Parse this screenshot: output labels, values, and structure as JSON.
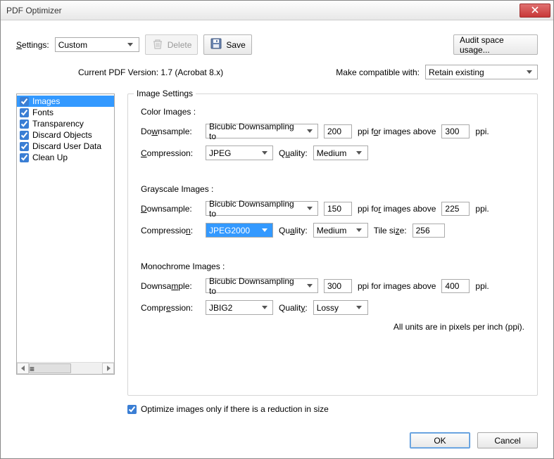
{
  "window": {
    "title": "PDF Optimizer"
  },
  "toolbar": {
    "settings_label": "Settings:",
    "settings_value": "Custom",
    "delete_label": "Delete",
    "save_label": "Save",
    "audit_label": "Audit space usage..."
  },
  "version_row": {
    "current_pdf": "Current PDF Version: 1.7 (Acrobat 8.x)",
    "compat_label": "Make compatible with:",
    "compat_value": "Retain existing"
  },
  "sidebar": {
    "items": [
      {
        "label": "Images",
        "checked": true,
        "selected": true
      },
      {
        "label": "Fonts",
        "checked": true,
        "selected": false
      },
      {
        "label": "Transparency",
        "checked": true,
        "selected": false
      },
      {
        "label": "Discard Objects",
        "checked": true,
        "selected": false
      },
      {
        "label": "Discard User Data",
        "checked": true,
        "selected": false
      },
      {
        "label": "Clean Up",
        "checked": true,
        "selected": false
      }
    ]
  },
  "panel": {
    "title": "Image Settings",
    "color": {
      "title": "Color Images :",
      "downsample_label": "Downsample:",
      "downsample_value": "Bicubic Downsampling to",
      "ppi1": "200",
      "above_label": "ppi for images above",
      "ppi2": "300",
      "ppi_suffix": "ppi.",
      "compression_label": "Compression:",
      "compression_value": "JPEG",
      "quality_label": "Quality:",
      "quality_value": "Medium"
    },
    "gray": {
      "title": "Grayscale Images :",
      "downsample_label": "Downsample:",
      "downsample_value": "Bicubic Downsampling to",
      "ppi1": "150",
      "above_label": "ppi for images above",
      "ppi2": "225",
      "ppi_suffix": "ppi.",
      "compression_label": "Compression:",
      "compression_value": "JPEG2000",
      "quality_label": "Quality:",
      "quality_value": "Medium",
      "tile_label": "Tile size:",
      "tile_value": "256"
    },
    "mono": {
      "title": "Monochrome Images :",
      "downsample_label": "Downsample:",
      "downsample_value": "Bicubic Downsampling to",
      "ppi1": "300",
      "above_label": "ppi for images above",
      "ppi2": "400",
      "ppi_suffix": "ppi.",
      "compression_label": "Compression:",
      "compression_value": "JBIG2",
      "quality_label": "Quality:",
      "quality_value": "Lossy"
    },
    "units_note": "All units are in pixels per inch (ppi)."
  },
  "optimize_only": {
    "label": "Optimize images only if there is a reduction in size",
    "checked": true
  },
  "buttons": {
    "ok": "OK",
    "cancel": "Cancel"
  }
}
